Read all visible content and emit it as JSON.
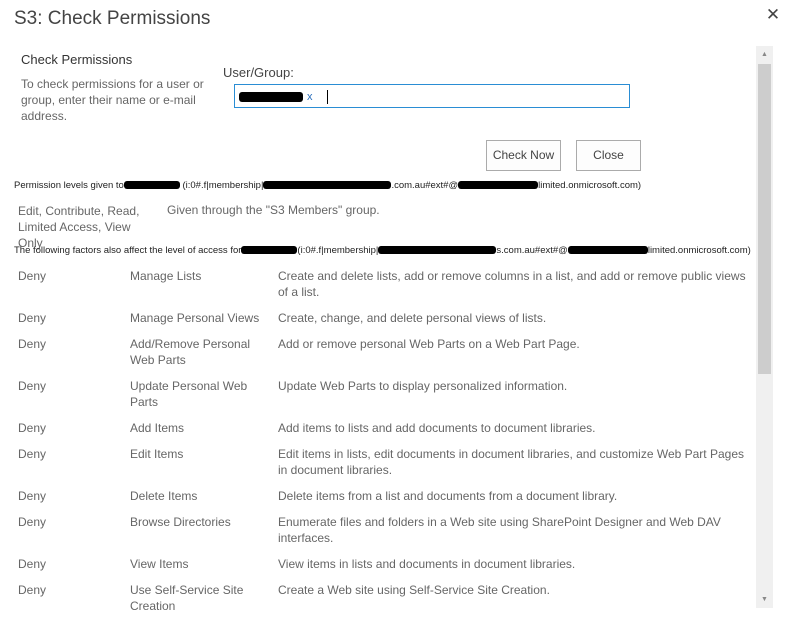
{
  "dialog": {
    "title": "S3: Check Permissions",
    "close_icon": "close-icon"
  },
  "check_section": {
    "heading": "Check Permissions",
    "description": "To check permissions for a user or group, enter their name or e-mail address.",
    "field_label": "User/Group:",
    "entity_remove": "x"
  },
  "buttons": {
    "check_now": "Check Now",
    "close": "Close"
  },
  "permission_levels": {
    "given_prefix": "Permission levels given to",
    "given_mid": "(i:0#.f|membership|",
    "given_mid2": ".com.au#ext#@",
    "given_suffix": "limited.onmicrosoft.com)",
    "levels": "Edit, Contribute, Read, Limited Access, View Only",
    "given_through": "Given through the \"S3 Members\" group."
  },
  "factors": {
    "intro_prefix": "The following factors also affect the level of access for",
    "intro_mid": "(i:0#.f|membership|",
    "intro_mid2": "s.com.au#ext#@",
    "intro_suffix": "limited.onmicrosoft.com)",
    "rows": [
      {
        "effect": "Deny",
        "permission": "Manage Lists",
        "description": "Create and delete lists, add or remove columns in a list, and add or remove public views of a list."
      },
      {
        "effect": "Deny",
        "permission": "Manage Personal Views",
        "description": "Create, change, and delete personal views of lists."
      },
      {
        "effect": "Deny",
        "permission": "Add/Remove Personal Web Parts",
        "description": "Add or remove personal Web Parts on a Web Part Page."
      },
      {
        "effect": "Deny",
        "permission": "Update Personal Web Parts",
        "description": "Update Web Parts to display personalized information."
      },
      {
        "effect": "Deny",
        "permission": "Add Items",
        "description": "Add items to lists and add documents to document libraries."
      },
      {
        "effect": "Deny",
        "permission": "Edit Items",
        "description": "Edit items in lists, edit documents in document libraries, and customize Web Part Pages in document libraries."
      },
      {
        "effect": "Deny",
        "permission": "Delete Items",
        "description": "Delete items from a list and documents from a document library."
      },
      {
        "effect": "Deny",
        "permission": "Browse Directories",
        "description": "Enumerate files and folders in a Web site using SharePoint Designer and Web DAV interfaces."
      },
      {
        "effect": "Deny",
        "permission": "View Items",
        "description": "View items in lists and documents in document libraries."
      },
      {
        "effect": "Deny",
        "permission": "Use Self-Service Site Creation",
        "description": "Create a Web site using Self-Service Site Creation."
      }
    ]
  },
  "scrollbar": {
    "up_icon": "scroll-up-arrow-icon",
    "down_icon": "scroll-down-arrow-icon"
  }
}
